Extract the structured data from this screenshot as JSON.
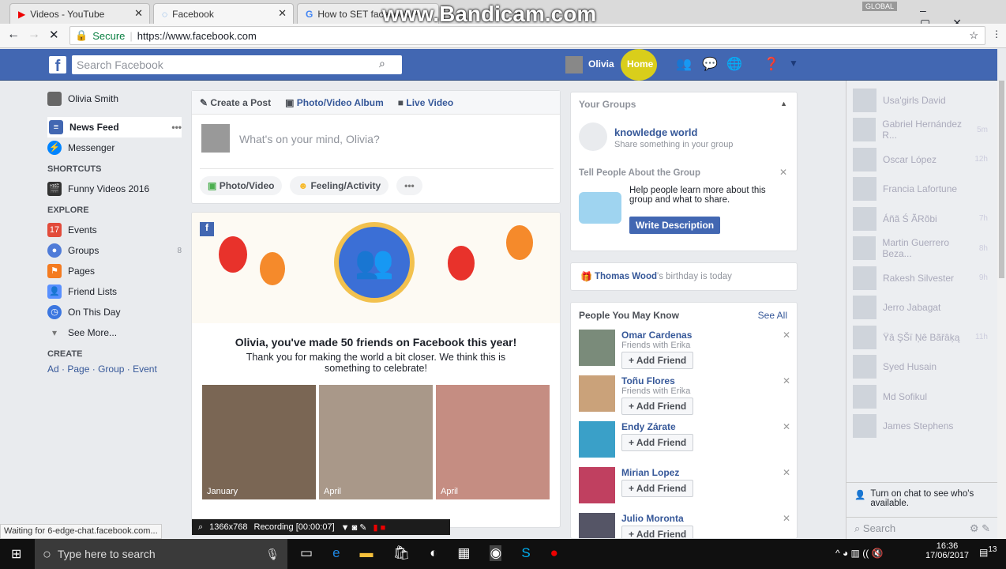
{
  "browser": {
    "tabs": [
      {
        "title": "Videos - YouTube"
      },
      {
        "title": "Facebook"
      },
      {
        "title": "How to SET facebook P"
      }
    ],
    "secure": "Secure",
    "url": "https://www.facebook.com",
    "watermark": "www.Bandicam.com",
    "global": "GLOBAL"
  },
  "header": {
    "search_placeholder": "Search Facebook",
    "user": "Olivia",
    "home": "Home"
  },
  "left_nav": {
    "profile": "Olivia Smith",
    "news_feed": "News Feed",
    "messenger": "Messenger",
    "shortcuts_title": "SHORTCUTS",
    "shortcut": "Funny Videos 2016",
    "explore_title": "EXPLORE",
    "explore": [
      {
        "label": "Events",
        "icon": "calendar-icon",
        "color": "#e24b3b"
      },
      {
        "label": "Groups",
        "icon": "groups-icon",
        "color": "#4f7bd8",
        "count": "8"
      },
      {
        "label": "Pages",
        "icon": "flag-icon",
        "color": "#f47b20"
      },
      {
        "label": "Friend Lists",
        "icon": "friends-icon",
        "color": "#5890ff"
      },
      {
        "label": "On This Day",
        "icon": "clock-icon",
        "color": "#3b76e0"
      }
    ],
    "see_more": "See More...",
    "create_title": "CREATE",
    "create_links": [
      "Ad",
      "Page",
      "Group",
      "Event"
    ]
  },
  "composer": {
    "tabs": [
      "Create a Post",
      "Photo/Video Album",
      "Live Video"
    ],
    "placeholder": "What's on your mind, Olivia?",
    "actions": [
      "Photo/Video",
      "Feeling/Activity"
    ]
  },
  "celebration": {
    "title": "Olivia, you've made 50 friends on Facebook this year!",
    "text": "Thank you for making the world a bit closer. We think this is something to celebrate!",
    "photos": [
      "January",
      "April",
      "April"
    ]
  },
  "groups": {
    "title": "Your Groups",
    "name": "knowledge world",
    "sub": "Share something in your group",
    "tell_title": "Tell People About the Group",
    "tell_text": "Help people learn more about this group and what to share.",
    "write_btn": "Write Description"
  },
  "birthday": {
    "name": "Thomas Wood",
    "text": "'s birthday is today"
  },
  "pymk": {
    "title": "People You May Know",
    "see_all": "See All",
    "add": "Add Friend",
    "people": [
      {
        "name": "Omar Cardenas",
        "mutual": "Friends with Erika"
      },
      {
        "name": "Toñu Flores",
        "mutual": "Friends with Erika"
      },
      {
        "name": "Endy Zárate",
        "mutual": ""
      },
      {
        "name": "Mirian Lopez",
        "mutual": ""
      },
      {
        "name": "Julio Moronta",
        "mutual": ""
      }
    ]
  },
  "chat": {
    "contacts": [
      {
        "name": "Usa'girls David",
        "time": ""
      },
      {
        "name": "Gabriel Hernández R...",
        "time": "5m"
      },
      {
        "name": "Oscar López",
        "time": "12h"
      },
      {
        "name": "Francia Lafortune",
        "time": ""
      },
      {
        "name": "Áñã Ś ÃRõbi",
        "time": "7h"
      },
      {
        "name": "Martin Guerrero Beza...",
        "time": "8h"
      },
      {
        "name": "Rakesh Silvester",
        "time": "9h"
      },
      {
        "name": "Jerro Jabagat",
        "time": ""
      },
      {
        "name": "Ÿâ ŞŠï Ņê Bãřâķą",
        "time": "11h"
      },
      {
        "name": "Syed Husain",
        "time": ""
      },
      {
        "name": "Md Sofikul",
        "time": ""
      },
      {
        "name": "James Stephens",
        "time": ""
      }
    ],
    "turn_on": "Turn on chat to see who's available.",
    "search": "Search"
  },
  "status": "Waiting for 6-edge-chat.facebook.com...",
  "recorder": {
    "res": "1366x768",
    "rec": "Recording [00:00:07]"
  },
  "taskbar": {
    "search": "Type here to search",
    "time": "16:36",
    "date": "17/06/2017",
    "notif": "13"
  }
}
